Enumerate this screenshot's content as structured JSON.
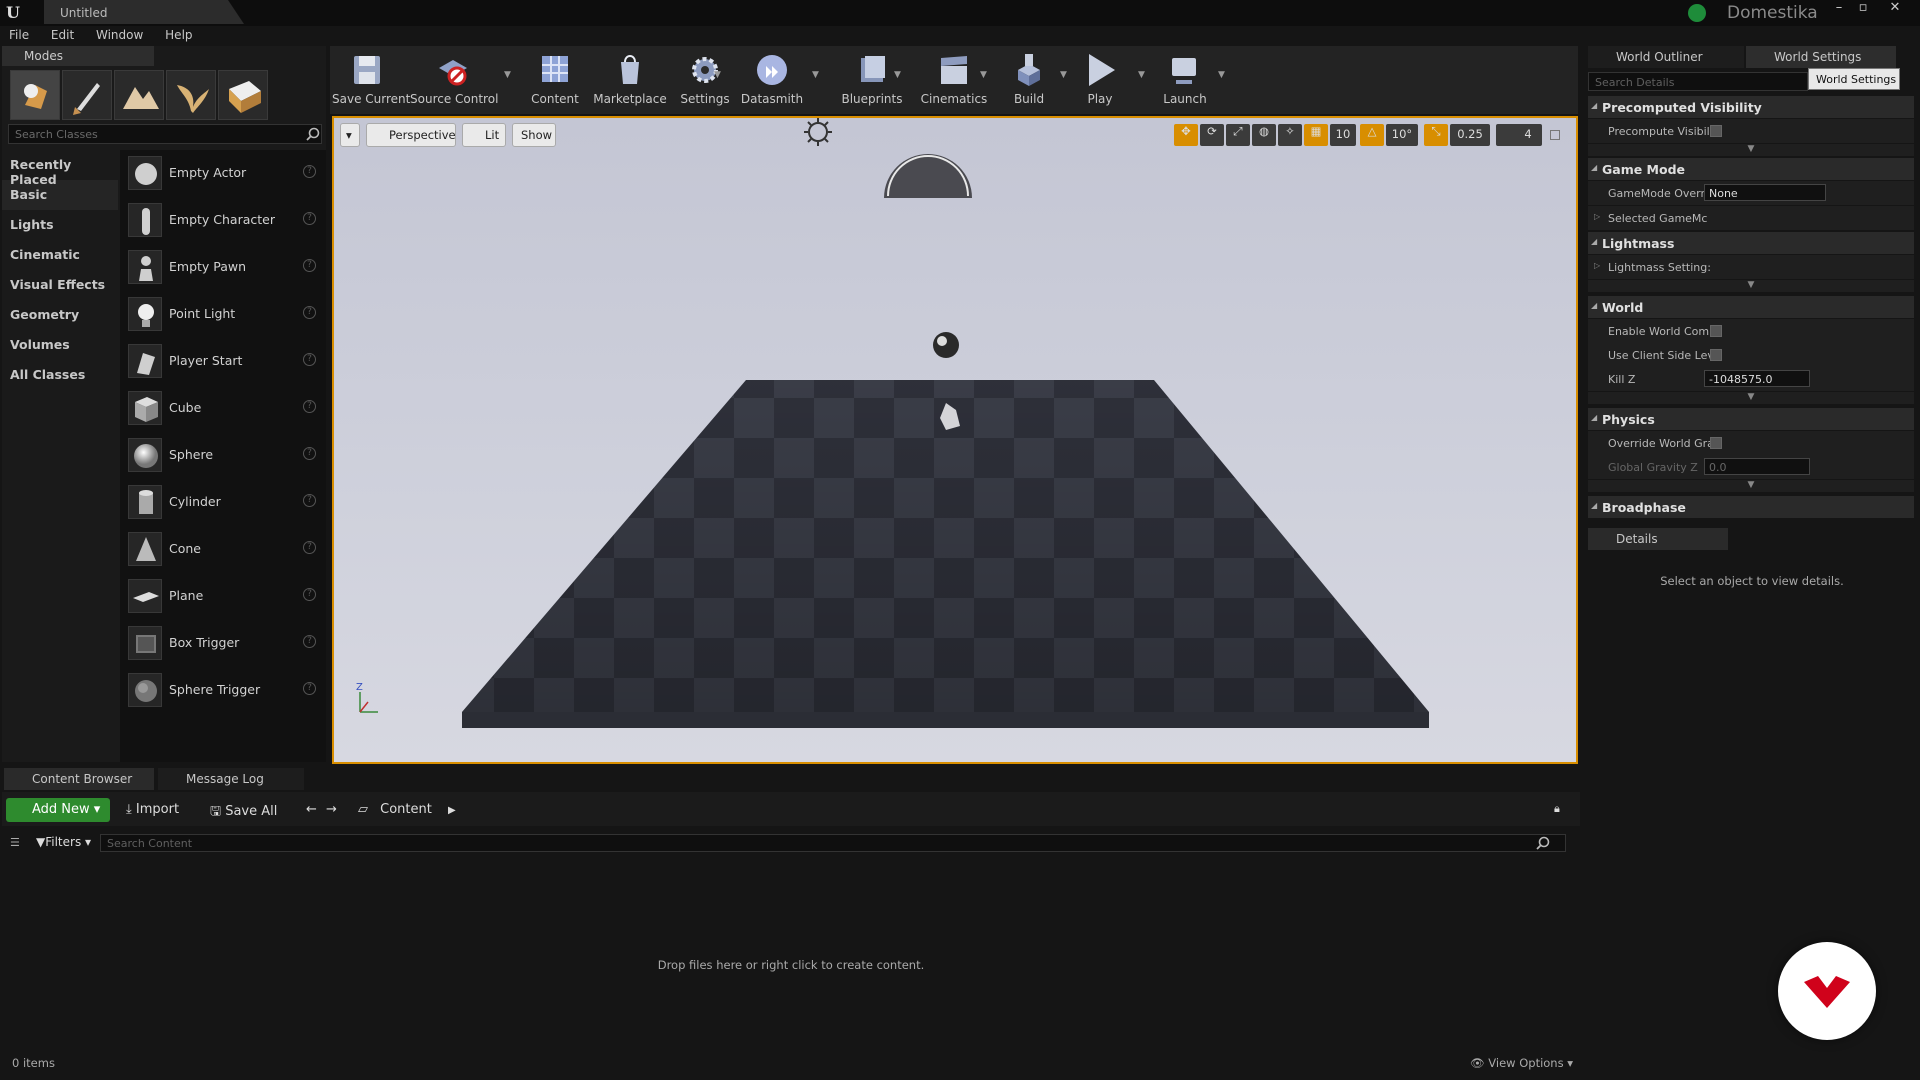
{
  "window": {
    "document_tab": "Untitled",
    "brand": "Domestika",
    "colors": {
      "accent": "#d88e00",
      "add_new": "#2e8b2e",
      "brand_red": "#d0021b"
    }
  },
  "menu": [
    "File",
    "Edit",
    "Window",
    "Help"
  ],
  "modes": {
    "tab_label": "Modes",
    "search_placeholder": "Search Classes",
    "categories": [
      "Recently Placed",
      "Basic",
      "Lights",
      "Cinematic",
      "Visual Effects",
      "Geometry",
      "Volumes",
      "All Classes"
    ],
    "active_category": "Basic",
    "classes": [
      "Empty Actor",
      "Empty Character",
      "Empty Pawn",
      "Point Light",
      "Player Start",
      "Cube",
      "Sphere",
      "Cylinder",
      "Cone",
      "Plane",
      "Box Trigger",
      "Sphere Trigger"
    ]
  },
  "toolbar": {
    "save_current": "Save Current",
    "source_control": "Source Control",
    "content": "Content",
    "marketplace": "Marketplace",
    "settings": "Settings",
    "datasmith": "Datasmith",
    "blueprints": "Blueprints",
    "cinematics": "Cinematics",
    "build": "Build",
    "play": "Play",
    "launch": "Launch"
  },
  "viewport": {
    "perspective": "Perspective",
    "lit": "Lit",
    "show": "Show",
    "grid_snap": "10",
    "rotation_snap": "10°",
    "scale_snap": "0.25",
    "camera_speed": "4"
  },
  "right_panel": {
    "world_outliner_tab": "World Outliner",
    "world_settings_tab": "World Settings",
    "search_placeholder": "Search Details",
    "tooltip": "World Settings",
    "sections": {
      "precomputed_visibility": "Precomputed Visibility",
      "precompute_visibility": "Precompute Visibil",
      "game_mode": "Game Mode",
      "gamemode_override": "GameMode Overri",
      "gamemode_value": "None",
      "selected_gamemode": "Selected GameMc",
      "lightmass": "Lightmass",
      "lightmass_settings": "Lightmass Setting:",
      "world": "World",
      "enable_world_comp": "Enable World Comp",
      "use_client_side": "Use Client Side Lev",
      "kill_z": "Kill Z",
      "kill_z_value": "-1048575.0",
      "physics": "Physics",
      "override_world_gravity": "Override World Gra",
      "global_gravity_z": "Global Gravity Z",
      "global_gravity_value": "0.0",
      "broadphase": "Broadphase"
    },
    "details_tab": "Details",
    "details_empty": "Select an object to view details."
  },
  "content_browser": {
    "tab": "Content Browser",
    "message_log_tab": "Message Log",
    "add_new": "Add New",
    "import": "Import",
    "save_all": "Save All",
    "path": "Content",
    "filters": "Filters",
    "search_placeholder": "Search Content",
    "empty_message": "Drop files here or right click to create content.",
    "item_count": "0 items",
    "view_options": "View Options"
  }
}
